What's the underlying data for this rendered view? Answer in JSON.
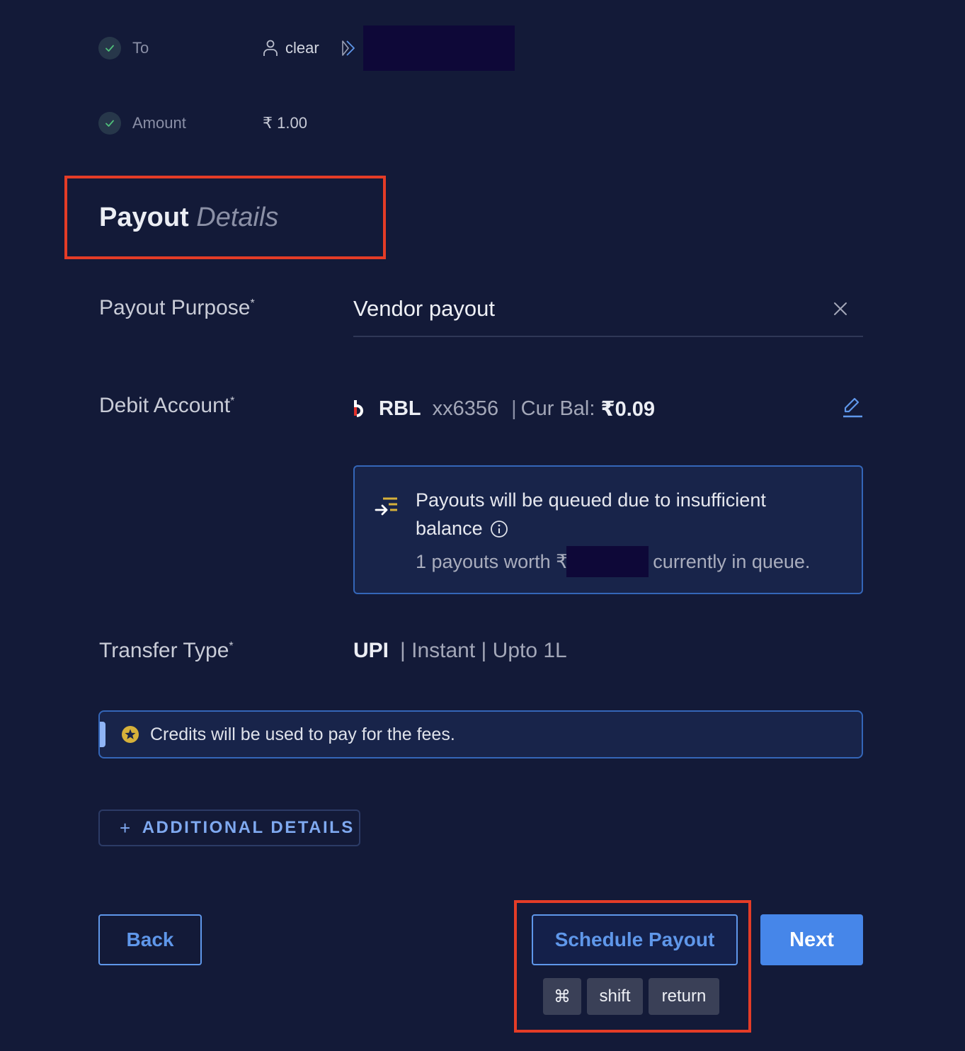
{
  "summary": {
    "to": {
      "label": "To",
      "recipient_icon": "person-icon",
      "recipient_name": "clear",
      "upi_icon": "upi-arrow-icon",
      "redacted": true
    },
    "amount": {
      "label": "Amount",
      "value": "₹ 1.00"
    }
  },
  "section": {
    "title_strong": "Payout",
    "title_light": "Details"
  },
  "form": {
    "payout_purpose": {
      "label": "Payout Purpose",
      "required_mark": "*",
      "value": "Vendor payout",
      "clear_icon": "close-icon"
    },
    "debit_account": {
      "label": "Debit Account",
      "required_mark": "*",
      "bank_logo": "rbl-bank-logo",
      "bank": "RBL",
      "account": "xx6356",
      "separator": "|",
      "balance_label": "Cur Bal:",
      "balance_value": "₹0.09",
      "edit_icon": "edit-icon"
    },
    "queue_notice": {
      "icon": "queue-icon",
      "line1": "Payouts will be queued due to insufficient",
      "line2": "balance",
      "info_icon": "info-icon",
      "line3_prefix": "1 payouts worth ₹",
      "line3_suffix": "currently in queue."
    },
    "transfer_type": {
      "label": "Transfer Type",
      "required_mark": "*",
      "mode": "UPI",
      "description": "| Instant | Upto 1L"
    },
    "credits_notice": {
      "icon": "star-coin-icon",
      "text": "Credits will be used to pay for the fees."
    },
    "additional_details": {
      "plus": "+",
      "label": "ADDITIONAL DETAILS"
    }
  },
  "actions": {
    "back": "Back",
    "schedule": "Schedule Payout",
    "next": "Next",
    "shortcut_keys": [
      "⌘",
      "shift",
      "return"
    ]
  },
  "colors": {
    "background": "#131a38",
    "accent": "#4686e9",
    "highlight": "#e43c27",
    "success": "#4fbf7a",
    "gold": "#d6b13a"
  }
}
